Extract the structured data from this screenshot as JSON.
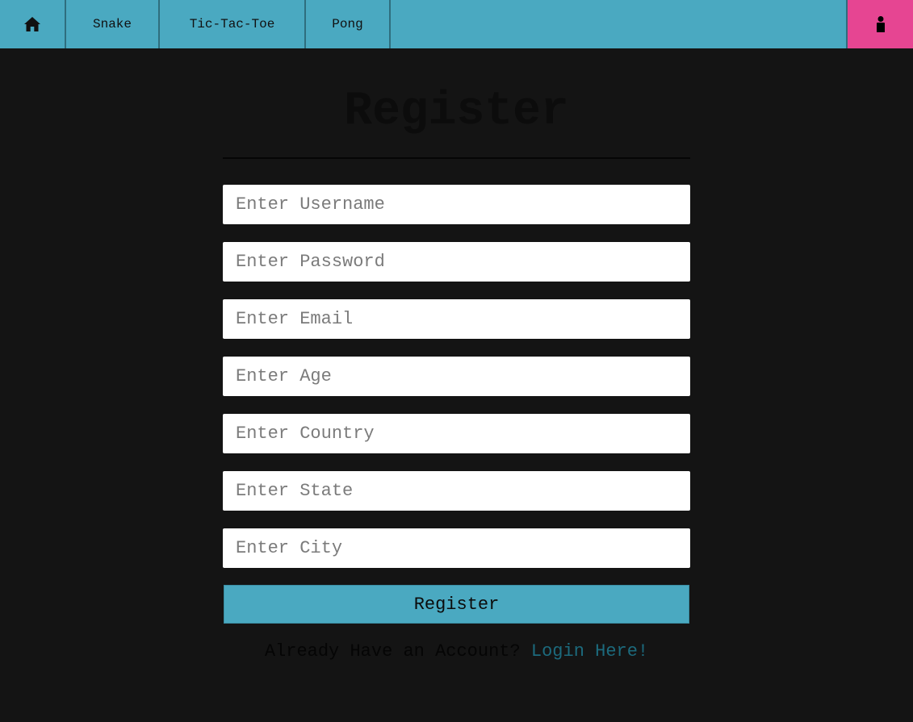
{
  "nav": {
    "home_icon": "home-icon",
    "items": [
      {
        "label": "Snake"
      },
      {
        "label": "Tic-Tac-Toe"
      },
      {
        "label": "Pong"
      }
    ],
    "user_icon": "user-icon",
    "accent_color": "#4aa9c1",
    "user_button_color": "#e64592"
  },
  "form": {
    "title": "Register",
    "fields": {
      "username": {
        "placeholder": "Enter Username",
        "value": ""
      },
      "password": {
        "placeholder": "Enter Password",
        "value": ""
      },
      "email": {
        "placeholder": "Enter Email",
        "value": ""
      },
      "age": {
        "placeholder": "Enter Age",
        "value": ""
      },
      "country": {
        "placeholder": "Enter Country",
        "value": ""
      },
      "state": {
        "placeholder": "Enter State",
        "value": ""
      },
      "city": {
        "placeholder": "Enter City",
        "value": ""
      }
    },
    "submit_label": "Register",
    "login_prompt": "Already Have an Account? ",
    "login_link": "Login Here!"
  }
}
